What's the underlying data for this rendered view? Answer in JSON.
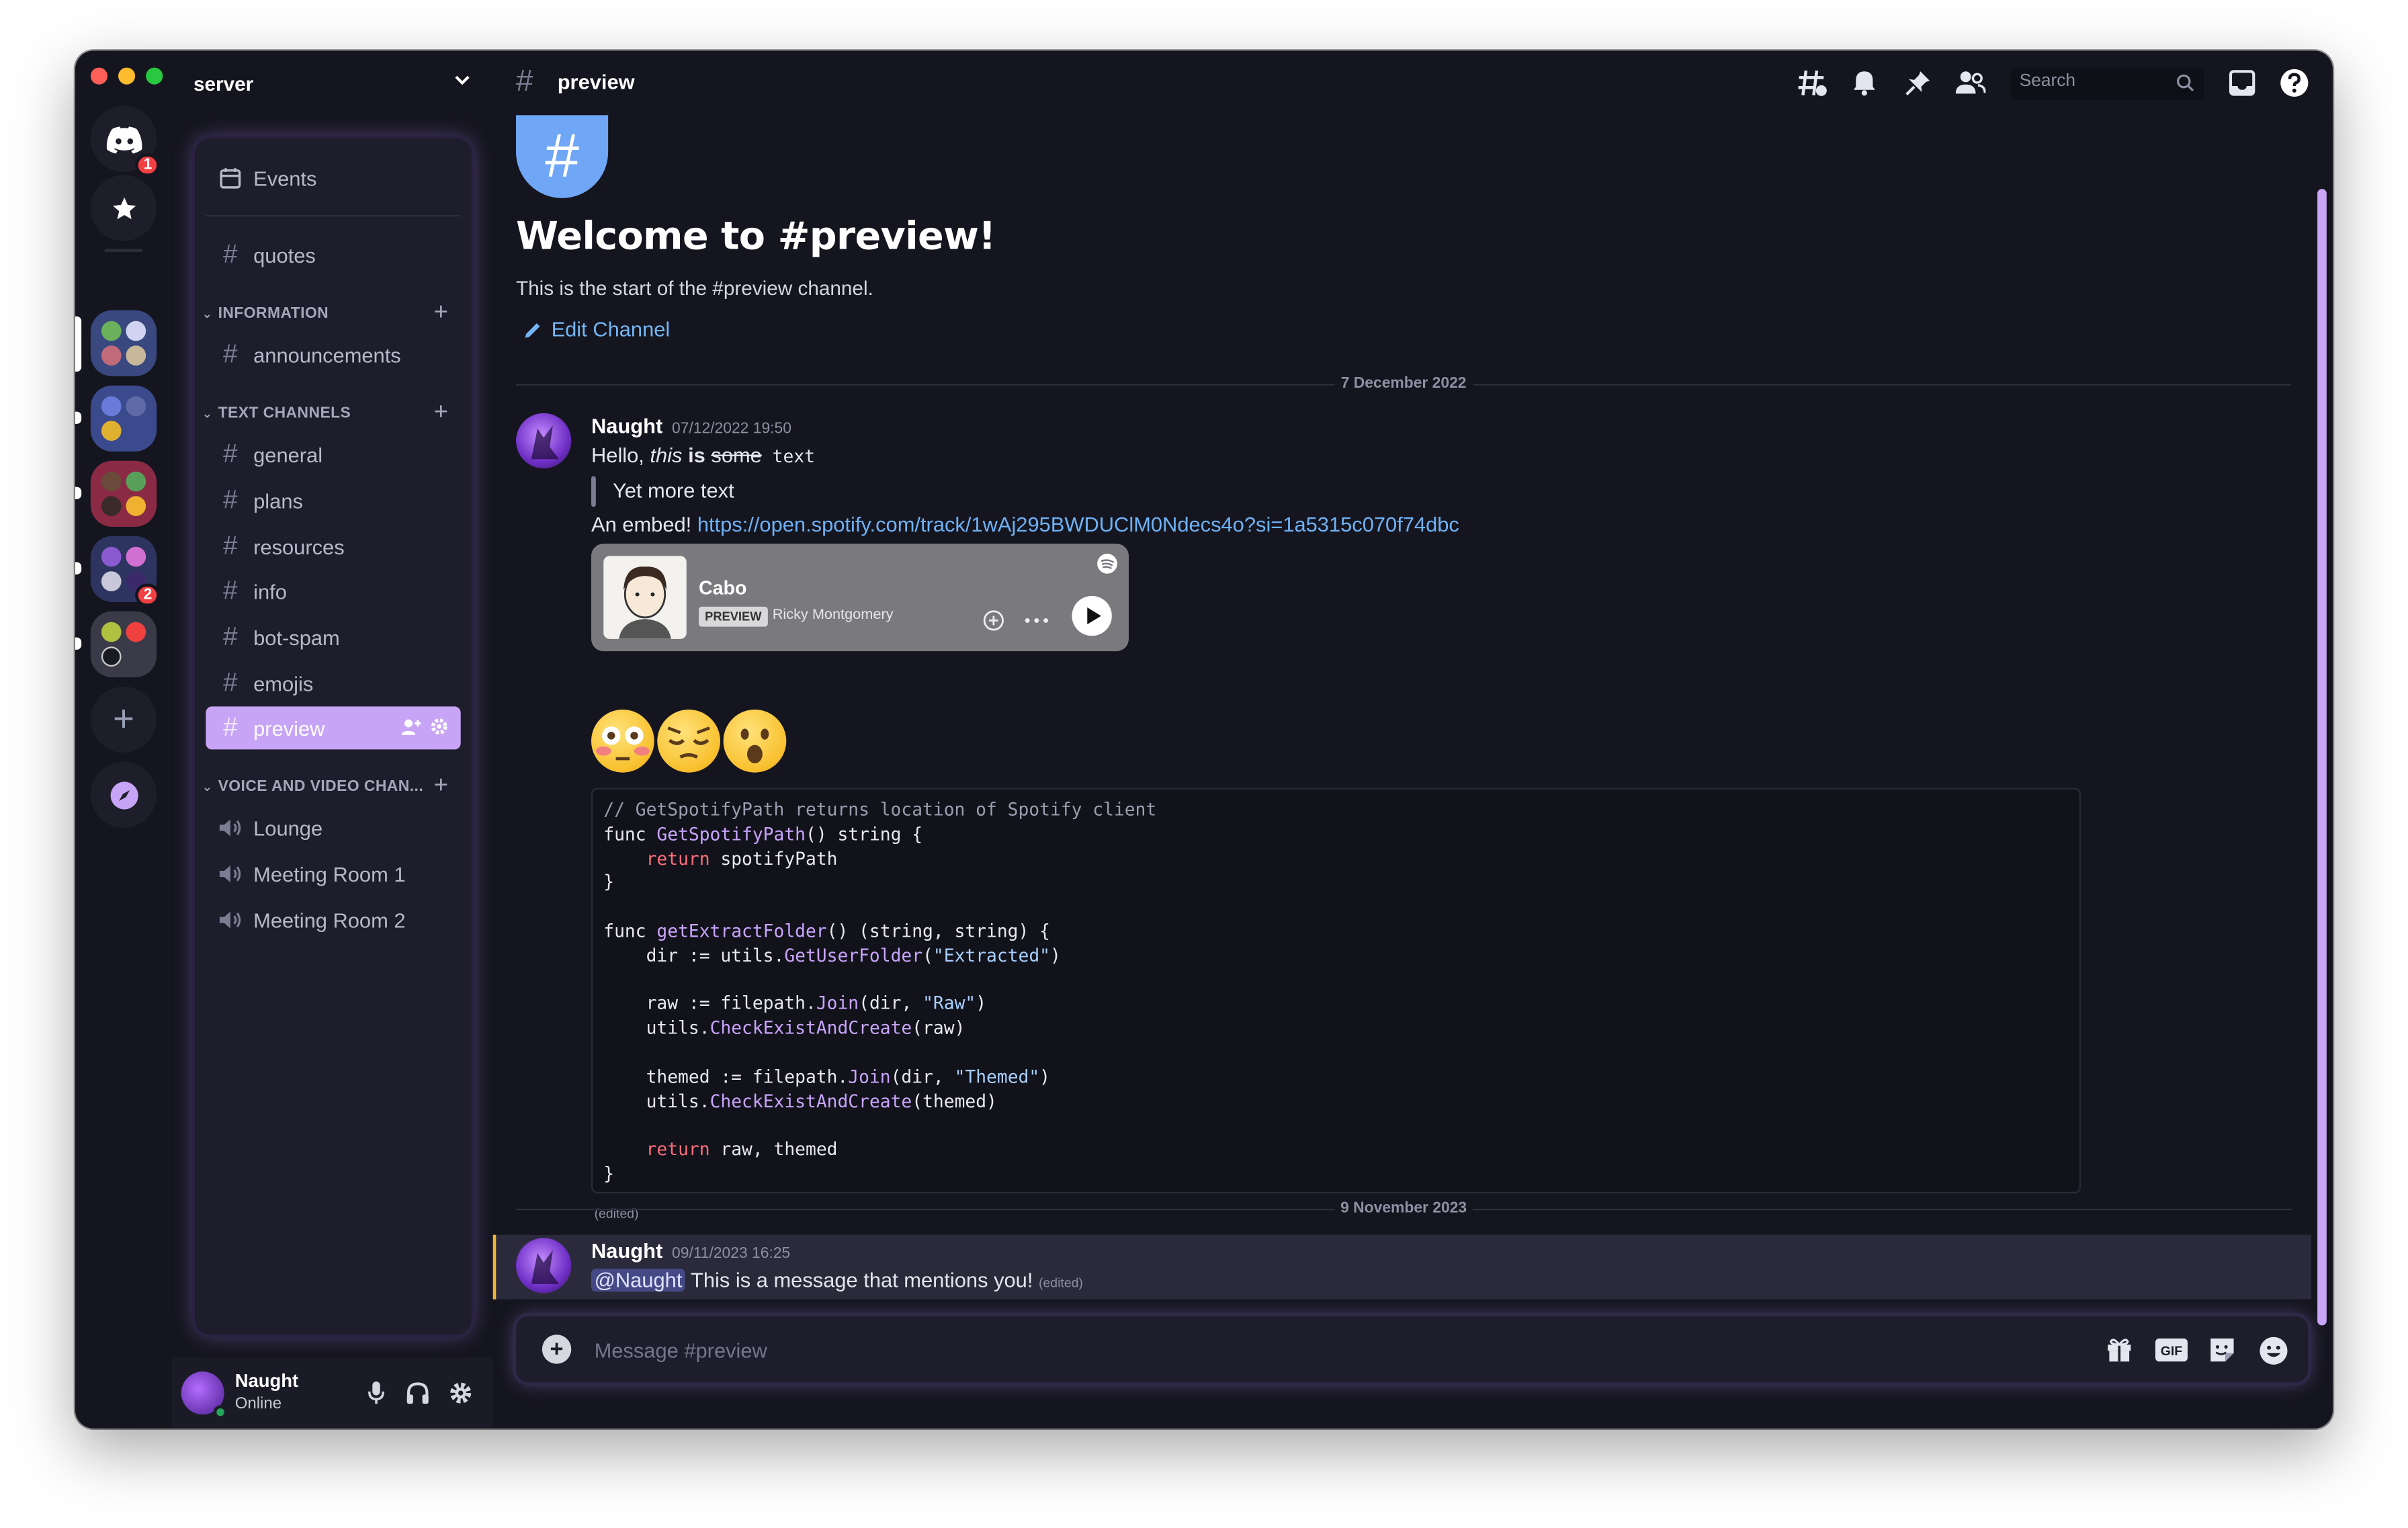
{
  "server": {
    "name": "server"
  },
  "rail": {
    "home_badge": "1",
    "folder4_badge": "2"
  },
  "channels": {
    "events_label": "Events",
    "quotes": "quotes",
    "categories": {
      "information": "INFORMATION",
      "text_channels": "TEXT CHANNELS",
      "voice": "VOICE AND VIDEO CHAN..."
    },
    "information_items": [
      "announcements"
    ],
    "text_items": [
      "general",
      "plans",
      "resources",
      "info",
      "bot-spam",
      "emojis",
      "preview"
    ],
    "voice_items": [
      "Lounge",
      "Meeting Room 1",
      "Meeting Room 2"
    ]
  },
  "user": {
    "name": "Naught",
    "status": "Online"
  },
  "topbar": {
    "channel": "preview",
    "search_placeholder": "Search"
  },
  "welcome": {
    "title": "Welcome to #preview!",
    "subtitle": "This is the start of the #preview channel.",
    "edit_label": "Edit Channel"
  },
  "dividers": [
    "7 December 2022",
    "9 November 2023"
  ],
  "message1": {
    "author": "Naught",
    "time": "07/12/2022 19:50",
    "line1_a": "Hello, ",
    "line1_italic": "this",
    "line1_bold": " is ",
    "line1_strike": "some",
    "line1_code": " text",
    "quote": "Yet more text",
    "embed_prefix": "An embed! ",
    "embed_url": "https://open.spotify.com/track/1wAj295BWDUClM0Ndecs4o?si=1a5315c070f74dbc",
    "spotify": {
      "title": "Cabo",
      "tag": "PREVIEW",
      "artist": "Ricky Montgomery"
    },
    "code_comment": "// GetSpotifyPath returns location of Spotify client",
    "edited": "(edited)"
  },
  "message2": {
    "author": "Naught",
    "time": "09/11/2023 16:25",
    "mention": "@Naught",
    "text": " This is a message that mentions you!",
    "edited": "(edited)"
  },
  "composer": {
    "placeholder": "Message #preview"
  },
  "colors": {
    "accent": "#c7a4f5",
    "background": "#15151f",
    "link": "#6fb2f6",
    "mention_bar": "#f0b232"
  }
}
